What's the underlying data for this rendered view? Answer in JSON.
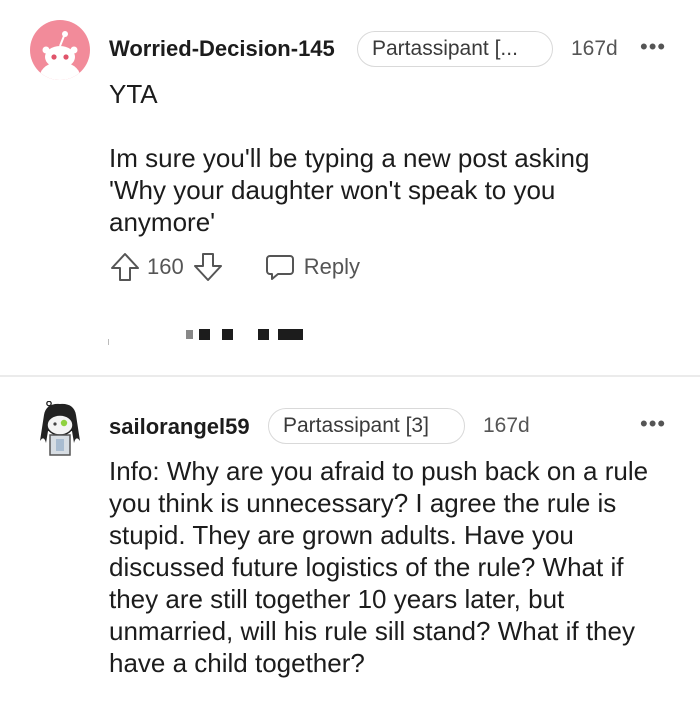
{
  "comments": [
    {
      "username": "Worried-Decision-145",
      "flair": "Partassipant [...",
      "age": "167d",
      "more": "•••",
      "lines": [
        "YTA",
        "",
        "Im sure you'll be typing a new post asking",
        "'Why your daughter won't speak to you",
        "anymore'"
      ],
      "upvotes": "160",
      "reply_label": "Reply"
    },
    {
      "username": "sailorangel59",
      "flair": "Partassipant [3]",
      "age": "167d",
      "more": "•••",
      "lines": [
        "Info: Why are you afraid to push back on a rule",
        "you think is unnecessary? I agree the rule is",
        "stupid. They are grown adults. Have you",
        "discussed future logistics of the rule? What if",
        "they are still together 10 years later, but",
        "unmarried, will his rule sill stand? What if they",
        "have a child together?"
      ]
    }
  ],
  "colors": {
    "avatar_bg": "#f28b9a",
    "divider": "#ebebeb",
    "text": "#1c1c1c",
    "meta": "#555555"
  }
}
